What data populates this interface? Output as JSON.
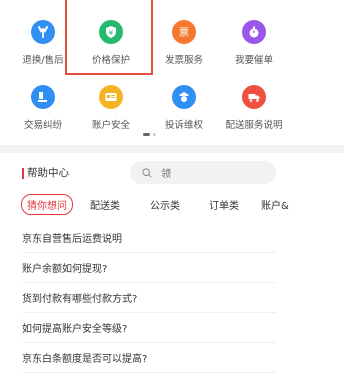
{
  "services": [
    {
      "label": "退换/售后",
      "icon": "wrench-icon",
      "color": "#2f8ff2"
    },
    {
      "label": "价格保护",
      "icon": "shield-yen-icon",
      "color": "#25b86f"
    },
    {
      "label": "发票服务",
      "icon": "invoice-icon",
      "color": "#f3782c"
    },
    {
      "label": "我要催单",
      "icon": "stopwatch-icon",
      "color": "#9a56e8"
    },
    {
      "label": "交易纠纷",
      "icon": "gavel-icon",
      "color": "#2f8ff2"
    },
    {
      "label": "账户安全",
      "icon": "id-card-icon",
      "color": "#f6b425"
    },
    {
      "label": "投诉维权",
      "icon": "officer-icon",
      "color": "#2f8ff2"
    },
    {
      "label": "配送服务说明",
      "icon": "truck-icon",
      "color": "#f0503f"
    }
  ],
  "help": {
    "title": "帮助中心",
    "search_placeholder": "领"
  },
  "tabs": [
    "猜你想问",
    "配送类",
    "公示类",
    "订单类",
    "账户&"
  ],
  "questions": [
    "京东自营售后运费说明",
    "账户余额如何提现?",
    "货到付款有哪些付款方式?",
    "如何提高账户安全等级?",
    "京东白条额度是否可以提高?"
  ]
}
